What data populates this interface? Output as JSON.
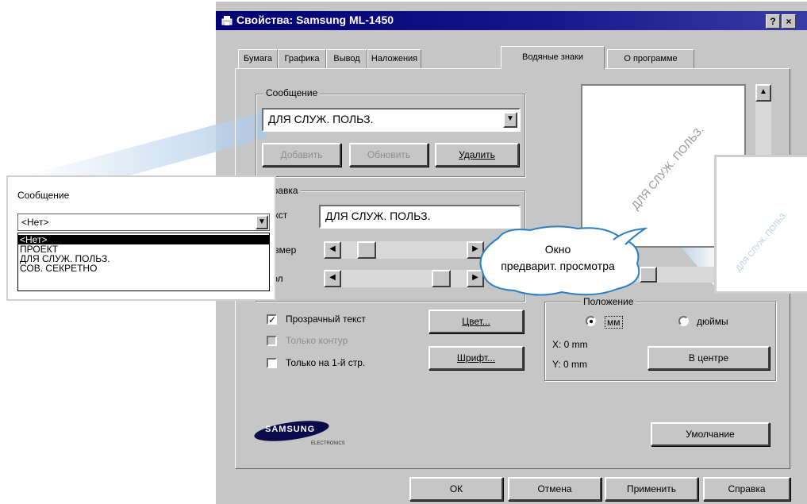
{
  "window": {
    "title": "Свойства: Samsung ML-1450",
    "help_label": "?",
    "close_label": "×"
  },
  "tabs": [
    {
      "label": "Бумага"
    },
    {
      "label": "Графика"
    },
    {
      "label": "Вывод"
    },
    {
      "label": "Наложения"
    },
    {
      "label": "Водяные знаки"
    },
    {
      "label": "О программе"
    }
  ],
  "message_group": {
    "label": "Сообщение",
    "selected": "ДЛЯ СЛУЖ. ПОЛЬЗ.",
    "add_button": "Добавить",
    "update_button": "Обновить",
    "delete_button": "Удалить"
  },
  "edit_group": {
    "label": "Правка",
    "text_label": "Текст",
    "text_value": "ДЛЯ СЛУЖ. ПОЛЬЗ.",
    "size_label": "Размер",
    "angle_label": "Угол",
    "size_level": 0.15,
    "angle_level": 0.85
  },
  "options": {
    "transparent_label": "Прозрачный текст",
    "transparent_checked": true,
    "outline_label": "Только контур",
    "first_page_label": "Только на 1-й стр.",
    "color_button": "Цвет...",
    "font_button": "Шрифт..."
  },
  "position_group": {
    "label": "Положение",
    "mm_label": "мм",
    "inches_label": "дюймы",
    "x_text": "X: 0 mm",
    "y_text": "Y: 0 mm",
    "center_button": "В центре"
  },
  "preview": {
    "watermark_text": "ДЛЯ СЛУЖ. ПОЛЬЗ."
  },
  "brand": {
    "logo_text": "SAMSUNG",
    "logo_sub": "ELECTRONICS"
  },
  "buttons": {
    "defaults": "Умолчание",
    "ok": "ОК",
    "cancel": "Отмена",
    "apply": "Применить",
    "help": "Справка"
  },
  "zoom_callout": {
    "label": "Сообщение",
    "selected": "<Нет>",
    "items": [
      "<Нет>",
      "ПРОЕКТ",
      "ДЛЯ СЛУЖ. ПОЛЬЗ.",
      "СОВ. СЕКРЕТНО"
    ]
  },
  "preview_callout": {
    "text_line1": "Окно",
    "text_line2": "предварит. просмотра",
    "zoom_watermark": "ДЛЯ СЛУЖ. ПОЛЬЗ."
  },
  "colors": {
    "dialog_bg": "#c6c6c6",
    "titlebar": "#000070",
    "callout_blue": "#bcd4ec"
  }
}
